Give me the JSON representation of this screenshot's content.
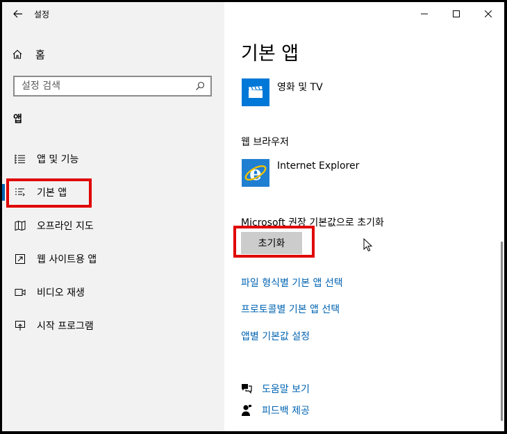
{
  "window": {
    "app_title": "설정"
  },
  "sidebar": {
    "home_label": "홈",
    "search_placeholder": "설정 검색",
    "section_label": "앱",
    "items": [
      {
        "label": "앱 및 기능",
        "icon": "list-icon"
      },
      {
        "label": "기본 앱",
        "icon": "default-apps-icon",
        "selected": true
      },
      {
        "label": "오프라인 지도",
        "icon": "map-icon"
      },
      {
        "label": "웹 사이트용 앱",
        "icon": "open-external-icon"
      },
      {
        "label": "비디오 재생",
        "icon": "video-icon"
      },
      {
        "label": "시작 프로그램",
        "icon": "startup-icon"
      }
    ]
  },
  "main": {
    "title": "기본 앱",
    "video_app": {
      "name": "영화 및 TV",
      "icon": "movies-tv-icon"
    },
    "browser_heading": "웹 브라우저",
    "browser_app": {
      "name": "Internet Explorer",
      "icon": "internet-explorer-icon"
    },
    "reset_heading": "Microsoft 권장 기본값으로 초기화",
    "reset_button": "초기화",
    "links": [
      "파일 형식별 기본 앱 선택",
      "프로토콜별 기본 앱 선택",
      "앱별 기본값 설정"
    ],
    "help_links": [
      {
        "label": "도움말 보기",
        "icon": "help-chat-icon"
      },
      {
        "label": "피드백 제공",
        "icon": "feedback-icon"
      }
    ]
  },
  "colors": {
    "accent": "#0063b1",
    "highlight_box": "#e00000",
    "sidebar_bg": "#f2f2f2",
    "button_bg": "#cccccc"
  }
}
